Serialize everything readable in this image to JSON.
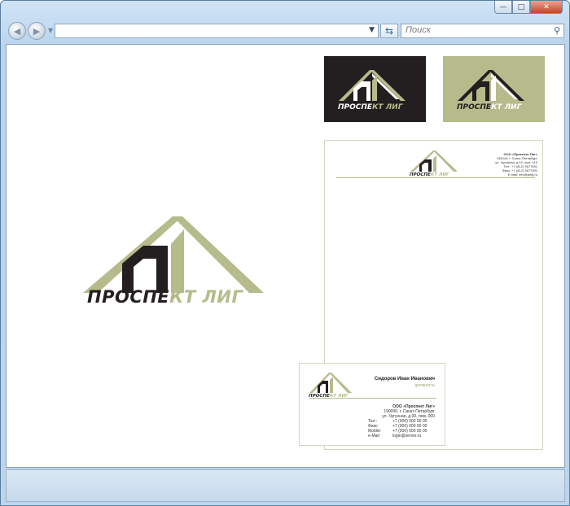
{
  "window": {
    "buttons": {
      "minimize": "—",
      "maximize": "□",
      "close": "✕"
    }
  },
  "toolbar": {
    "back_icon": "back-arrow-icon",
    "forward_icon": "forward-arrow-icon",
    "address_value": "",
    "search_placeholder": "Поиск"
  },
  "brand": {
    "name_dark_part": "ПРОСПЕ",
    "name_light_part": "КТ ЛИГ",
    "name_full": "ПРОСПЕКТ ЛИГ",
    "colors": {
      "dark": "#231f20",
      "sage": "#b6bb8c",
      "white": "#ffffff"
    }
  },
  "letterhead": {
    "company": "ООО «Проспект Лиг»",
    "lines": [
      "194044, г. Санкт-Петербург",
      "ул. Чугунная, д.14, пом. 410",
      "Тел.: +7 (812) 3677591",
      "Факс: +7 (812) 3677092",
      "E-mail: info@prlig.ru"
    ]
  },
  "business_card": {
    "person_name": "Сидоров Иван Иванович",
    "position": "должность",
    "company": "ООО «Проспект Лиг»",
    "address": [
      "190000, г. Санкт-Петербург",
      "ул. Чугунная, д.00, пом. 000"
    ],
    "contacts": [
      {
        "label": "Тел.:",
        "value": "+7 (000) 000 00 00"
      },
      {
        "label": "Факс:",
        "value": "+7 (000) 000 00 00"
      },
      {
        "label": "Mobile:",
        "value": "+7 (000) 000 00 00"
      },
      {
        "label": "e-Mail:",
        "value": "login@server.ru"
      }
    ]
  }
}
